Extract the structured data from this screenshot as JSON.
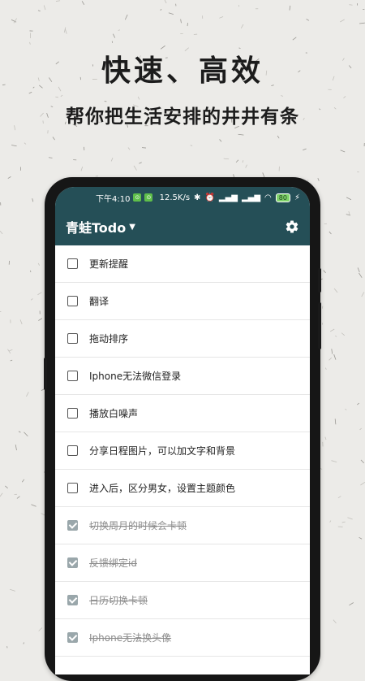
{
  "promo": {
    "headline": "快速、高效",
    "subline": "帮你把生活安排的井井有条"
  },
  "status_bar": {
    "time": "下午4:10",
    "speed": "12.5K/s",
    "battery": "80"
  },
  "app": {
    "title": "青蛙Todo",
    "header_color": "#254f57"
  },
  "todos": [
    {
      "text": "更新提醒",
      "done": false
    },
    {
      "text": "翻译",
      "done": false
    },
    {
      "text": "拖动排序",
      "done": false
    },
    {
      "text": "Iphone无法微信登录",
      "done": false
    },
    {
      "text": "播放白噪声",
      "done": false
    },
    {
      "text": "分享日程图片，可以加文字和背景",
      "done": false
    },
    {
      "text": "进入后，区分男女，设置主题颜色",
      "done": false
    },
    {
      "text": "切换周月的时候会卡顿",
      "done": true
    },
    {
      "text": "反馈绑定id",
      "done": true
    },
    {
      "text": "日历切换卡顿",
      "done": true
    },
    {
      "text": "Iphone无法换头像",
      "done": true
    }
  ]
}
